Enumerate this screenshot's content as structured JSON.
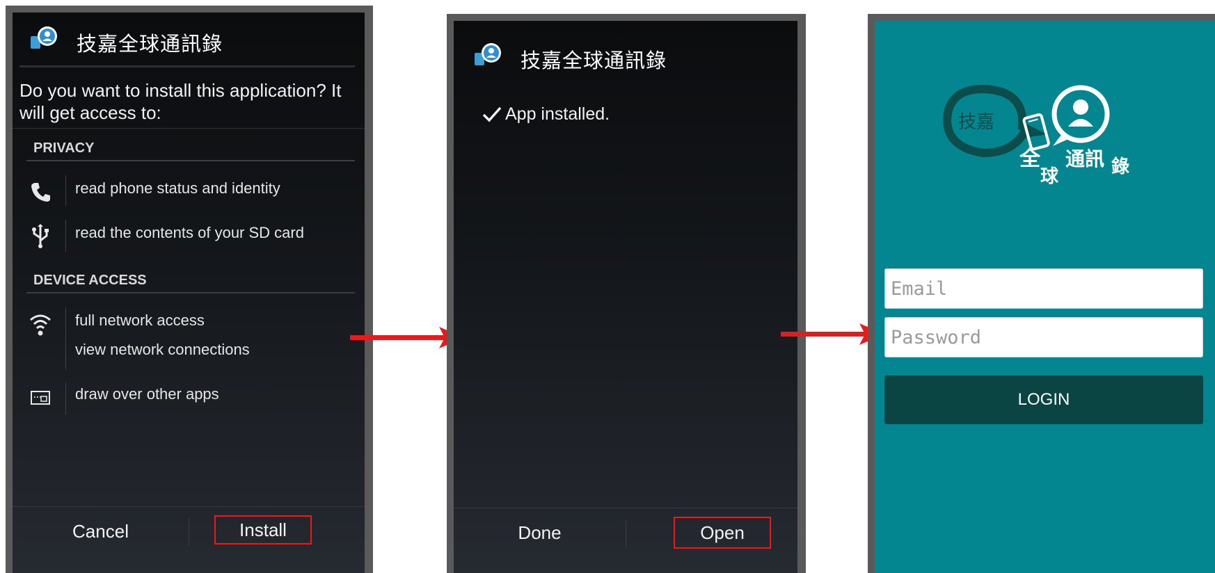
{
  "app": {
    "title": "技嘉全球通訊錄"
  },
  "install_screen": {
    "question": "Do you want to install this application? It will get access to:",
    "sections": [
      {
        "title": "PRIVACY",
        "permissions": [
          {
            "icon": "phone-icon",
            "text": "read phone status and identity"
          },
          {
            "icon": "usb-icon",
            "text": "read the contents of your SD card"
          }
        ]
      },
      {
        "title": "DEVICE ACCESS",
        "permissions": [
          {
            "icon": "wifi-icon",
            "text": "full network access",
            "extra": "view network connections"
          },
          {
            "icon": "overlay-window-icon",
            "text": "draw over other apps"
          }
        ]
      }
    ],
    "cancel_label": "Cancel",
    "install_label": "Install"
  },
  "installed_screen": {
    "message": "App installed.",
    "done_label": "Done",
    "open_label": "Open"
  },
  "login_screen": {
    "logo_text": {
      "bubble": "技嘉",
      "line2": "全",
      "line3": "球",
      "rest": "通訊",
      "last": "錄"
    },
    "email_placeholder": "Email",
    "password_placeholder": "Password",
    "login_label": "LOGIN"
  },
  "colors": {
    "highlight": "#e81a1a",
    "login_bg": "#03868f",
    "login_button": "#0b4543"
  }
}
